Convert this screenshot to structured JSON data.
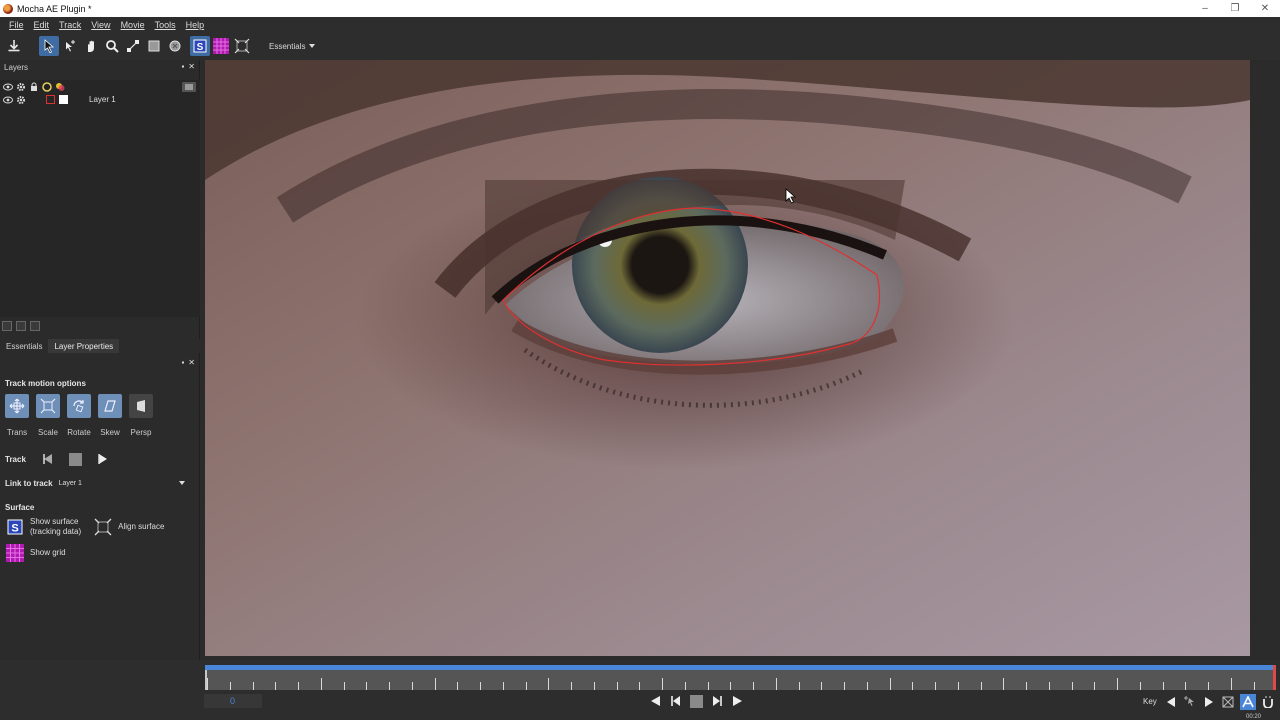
{
  "window": {
    "title": "Mocha AE Plugin *",
    "controls": [
      "–",
      "❐",
      "✕"
    ]
  },
  "menu": [
    "File",
    "Edit",
    "Track",
    "View",
    "Movie",
    "Tools",
    "Help"
  ],
  "toolbar": {
    "workspace": "Essentials"
  },
  "layers_panel": {
    "title": "Layers",
    "layers": [
      {
        "name": "Layer 1",
        "color": "#e03030"
      }
    ]
  },
  "tabs": [
    {
      "label": "Essentials",
      "active": false
    },
    {
      "label": "Layer Properties",
      "active": true
    }
  ],
  "track_motion": {
    "title": "Track motion options",
    "options": [
      {
        "label": "Trans",
        "on": true
      },
      {
        "label": "Scale",
        "on": true
      },
      {
        "label": "Rotate",
        "on": true
      },
      {
        "label": "Skew",
        "on": true
      },
      {
        "label": "Persp",
        "on": false
      }
    ]
  },
  "track": {
    "label": "Track"
  },
  "link": {
    "label": "Link to track",
    "value": "Layer 1"
  },
  "surface": {
    "title": "Surface",
    "show_surface_line1": "Show surface",
    "show_surface_line2": "(tracking data)",
    "align_surface": "Align surface",
    "show_grid": "Show grid"
  },
  "timeline": {
    "frame": "0",
    "key_label": "Key",
    "end_time": "00:20"
  },
  "colors": {
    "accent": "#4a86d8",
    "spline": "#e03030",
    "selected_tool": "#3f6da3"
  }
}
